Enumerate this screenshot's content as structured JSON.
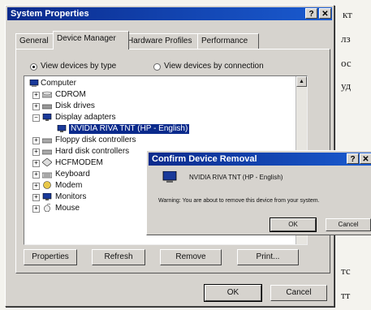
{
  "window": {
    "title": "System Properties",
    "help_glyph": "?",
    "close_glyph": "✕"
  },
  "tabs": [
    {
      "label": "General"
    },
    {
      "label": "Device Manager"
    },
    {
      "label": "Hardware Profiles"
    },
    {
      "label": "Performance"
    }
  ],
  "view_options": {
    "by_type": "View devices by type",
    "by_connection": "View devices by connection",
    "selected": "by_type"
  },
  "tree": {
    "root": "Computer",
    "items": [
      {
        "label": "CDROM",
        "expander": "+",
        "icon": "cdrom-icon"
      },
      {
        "label": "Disk drives",
        "expander": "+",
        "icon": "disk-drive-icon"
      },
      {
        "label": "Display adapters",
        "expander": "−",
        "icon": "display-adapter-icon"
      },
      {
        "label": "NVIDIA RIVA TNT (HP - English)",
        "expander": "",
        "icon": "monitor-icon",
        "child": true,
        "selected": true
      },
      {
        "label": "Floppy disk controllers",
        "expander": "+",
        "icon": "floppy-controller-icon"
      },
      {
        "label": "Hard disk controllers",
        "expander": "+",
        "icon": "hard-disk-controller-icon"
      },
      {
        "label": "HCFMODEM",
        "expander": "+",
        "icon": "modem-diamond-icon"
      },
      {
        "label": "Keyboard",
        "expander": "+",
        "icon": "keyboard-icon"
      },
      {
        "label": "Modem",
        "expander": "+",
        "icon": "modem-icon"
      },
      {
        "label": "Monitors",
        "expander": "+",
        "icon": "monitor-icon"
      },
      {
        "label": "Mouse",
        "expander": "+",
        "icon": "mouse-icon"
      }
    ]
  },
  "buttons": {
    "properties": "Properties",
    "refresh": "Refresh",
    "remove": "Remove",
    "print": "Print...",
    "ok": "OK",
    "cancel": "Cancel"
  },
  "dialog": {
    "title": "Confirm Device Removal",
    "device_name": "NVIDIA RIVA TNT (HP - English)",
    "warning": "Warning: You are about to remove this device from your system.",
    "ok": "OK",
    "cancel": "Cancel",
    "help_glyph": "?",
    "close_glyph": "✕"
  },
  "background_text": [
    "кт",
    "лз",
    "ос",
    "уд",
    "тс",
    "тт"
  ]
}
